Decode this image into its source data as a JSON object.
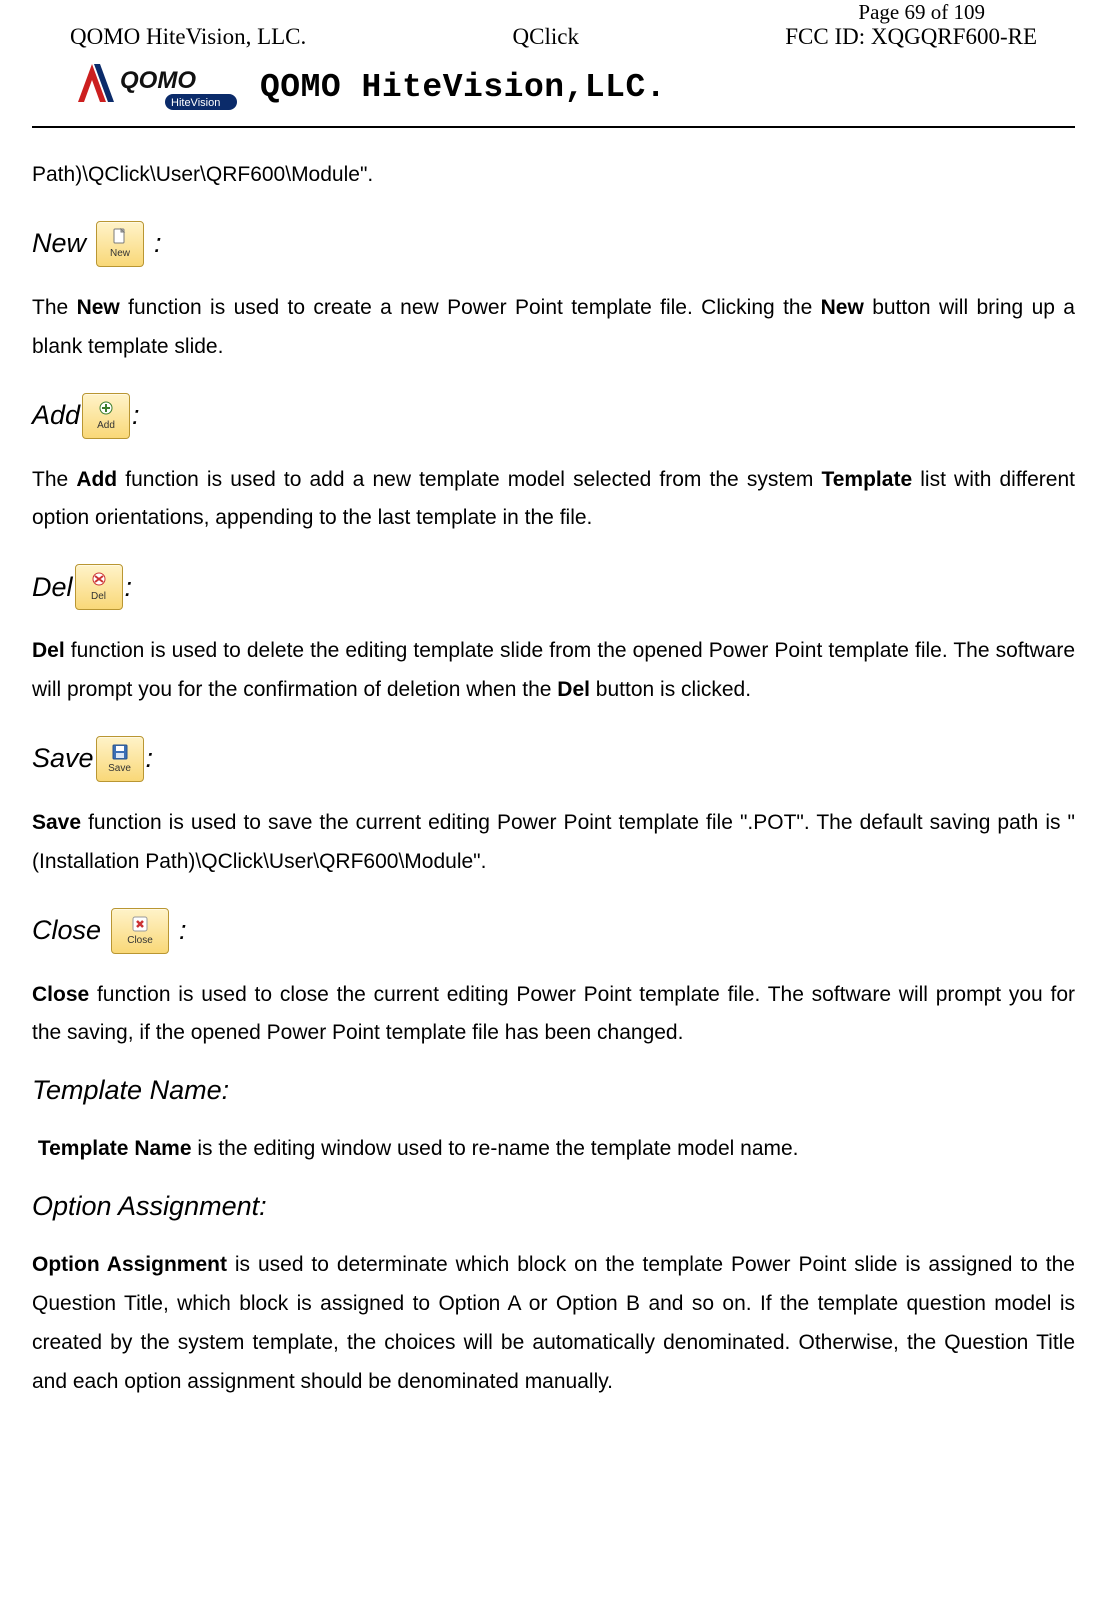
{
  "page": {
    "numPrefix": "Page ",
    "numCurrent": "69",
    "numOf": " of ",
    "numTotal": "109"
  },
  "header": {
    "left": "QOMO HiteVision, LLC.",
    "center": "QClick",
    "right": "FCC ID: XQGQRF600-RE",
    "companyTitle": "QOMO HiteVision,LLC.",
    "logoText": "QOMO",
    "logoSub": "HiteVision"
  },
  "intro": {
    "pathTail": "Path)\\QClick\\User\\QRF600\\Module\"."
  },
  "sections": {
    "new": {
      "title": "New",
      "iconLabel": "New",
      "desc_pre": "The ",
      "desc_b1": "New",
      "desc_mid": " function is used to create a new Power Point template file. Clicking the ",
      "desc_b2": "New",
      "desc_post": " button will bring up a blank template slide."
    },
    "add": {
      "title": "Add",
      "iconLabel": "Add",
      "desc_pre": "The ",
      "desc_b1": "Add",
      "desc_mid": " function is used to add a new template model selected from the system ",
      "desc_b2": "Template",
      "desc_post": " list with different option orientations, appending to the last template in the file."
    },
    "del": {
      "title": "Del",
      "iconLabel": "Del",
      "desc_b1": "Del",
      "desc_mid": " function is used to delete the editing template slide from the opened Power Point template file. The software will prompt you for the confirmation of deletion when the ",
      "desc_b2": "Del",
      "desc_post": " button is clicked."
    },
    "save": {
      "title": "Save",
      "iconLabel": "Save",
      "desc_b1": "Save",
      "desc_post": " function is used to save the current editing Power Point template file \".POT\". The default saving path is \"(Installation Path)\\QClick\\User\\QRF600\\Module\"."
    },
    "close": {
      "title": "Close",
      "iconLabel": "Close",
      "desc_b1": "Close",
      "desc_post": " function is used to close the current editing Power Point template file. The software will prompt you for the saving, if the opened Power Point template file has been changed."
    },
    "templateName": {
      "title": "Template Name:",
      "desc_b1": "Template Name",
      "desc_post": " is the editing window used to re-name the template model name."
    },
    "optionAssignment": {
      "title": "Option Assignment:",
      "desc_b1": "Option Assignment",
      "desc_post": " is used to determinate which block on the template Power Point slide is assigned to the Question Title, which block is assigned to Option A or Option B and so on. If  the template question  model  is  created  by  the  system  template, the  choices  will  be automatically denominated. Otherwise, the Question Title and each option assignment should be denominated manually."
    }
  },
  "colon": ":"
}
